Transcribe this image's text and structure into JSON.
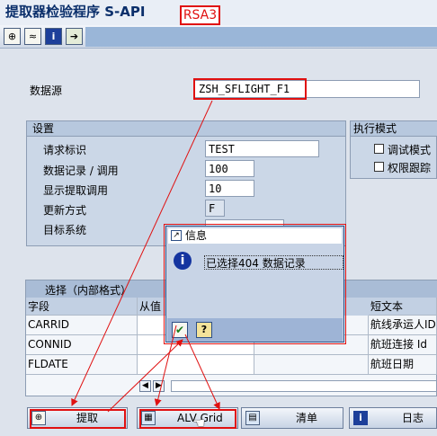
{
  "window": {
    "title": "提取器检验程序 S-API",
    "annotation": "RSA3"
  },
  "toolbar": {
    "icons": [
      "execute-icon",
      "variant-icon",
      "info-icon",
      "export-icon"
    ]
  },
  "datasource": {
    "label": "数据源",
    "value": "ZSH_SFLIGHT_F1"
  },
  "settings": {
    "title": "设置",
    "rows": [
      {
        "label": "请求标识",
        "value": "TEST"
      },
      {
        "label": "数据记录 / 调用",
        "value": "100"
      },
      {
        "label": "显示提取调用",
        "value": "10"
      },
      {
        "label": "更新方式",
        "value": "F"
      },
      {
        "label": "目标系统",
        "value": ""
      }
    ]
  },
  "exec_mode": {
    "title": "执行模式",
    "options": [
      "调试模式",
      "权限跟踪"
    ]
  },
  "selection": {
    "title": "选择（内部格式）",
    "columns": [
      "字段",
      "从值",
      "短文本"
    ],
    "rows": [
      {
        "field": "CARRID",
        "text": "航线承运人ID"
      },
      {
        "field": "CONNID",
        "text": "航班连接 Id"
      },
      {
        "field": "FLDATE",
        "text": "航班日期"
      }
    ]
  },
  "buttons": {
    "extract": "提取",
    "alv": "ALV Grid",
    "list": "清单",
    "log": "日志"
  },
  "dialog": {
    "title": "信息",
    "message": "已选择404 数据记录"
  }
}
